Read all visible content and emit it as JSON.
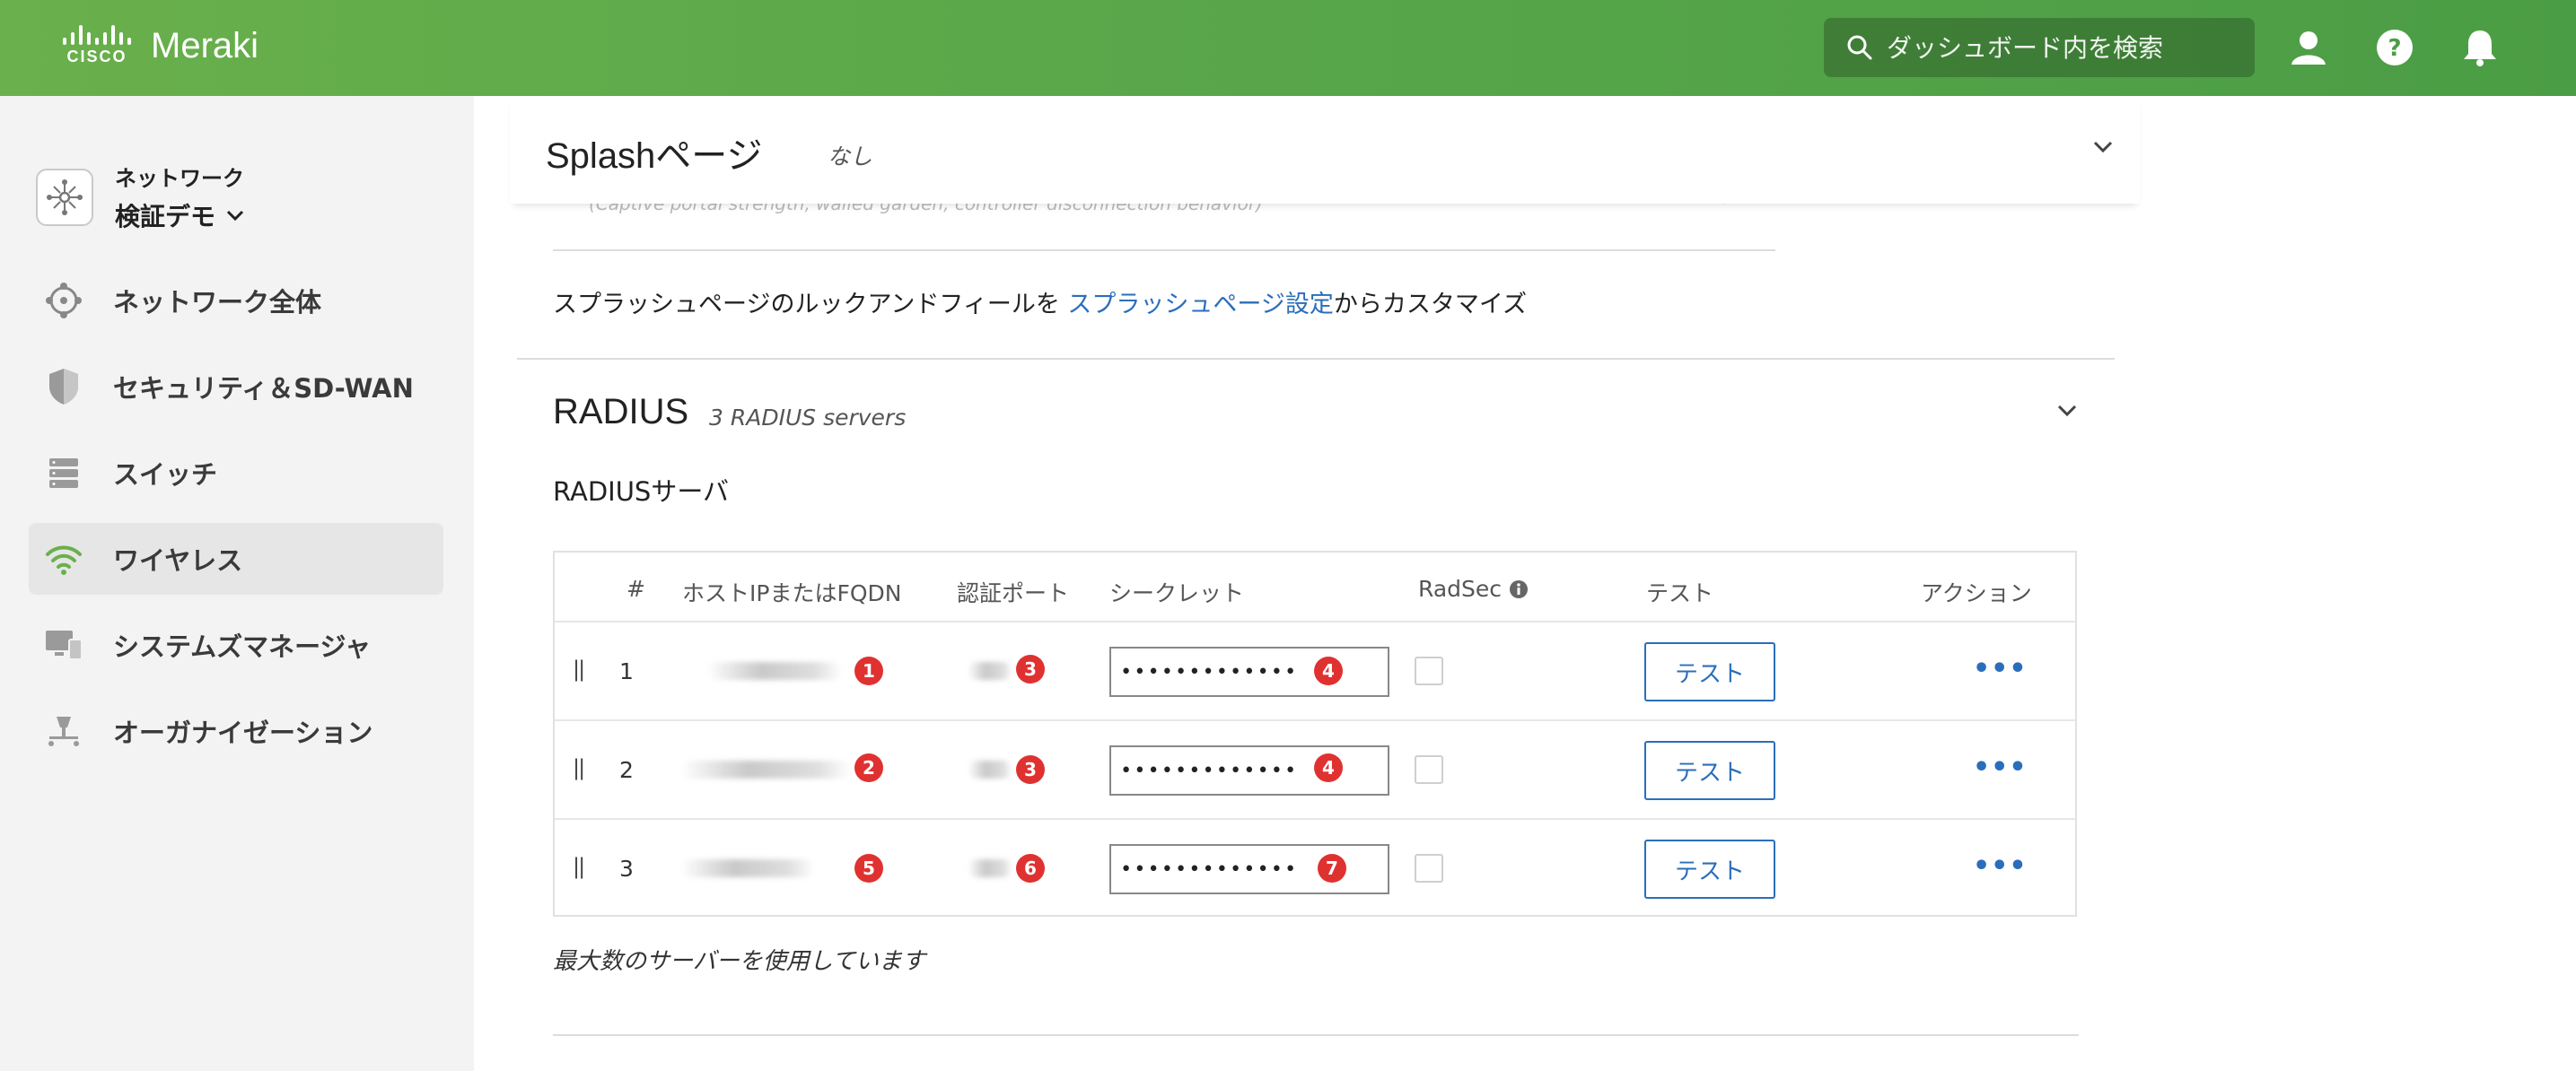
{
  "header": {
    "brand_small": "CISCO",
    "brand": "Meraki",
    "search_placeholder": "ダッシュボード内を検索",
    "colors": {
      "bar_start": "#6ab04c",
      "bar_end": "#4b9d45"
    }
  },
  "sidebar": {
    "network_label": "ネットワーク",
    "network_name": "検証デモ",
    "items": [
      {
        "label": "ネットワーク全体",
        "icon": "network-icon"
      },
      {
        "label": "セキュリティ＆SD-WAN",
        "icon": "shield-icon"
      },
      {
        "label": "スイッチ",
        "icon": "switch-icon"
      },
      {
        "label": "ワイヤレス",
        "icon": "wifi-icon",
        "active": true
      },
      {
        "label": "システムズマネージャ",
        "icon": "devices-icon"
      },
      {
        "label": "オーガナイゼーション",
        "icon": "org-icon"
      }
    ]
  },
  "splash": {
    "title": "Splashページ",
    "status": "なし",
    "faded_row": "(Captive portal strength, walled garden, controller disconnection behavior)",
    "customize_prefix": "スプラッシュページのルックアンドフィールを ",
    "customize_link": "スプラッシュページ設定",
    "customize_suffix": "からカスタマイズ"
  },
  "radius": {
    "title": "RADIUS",
    "summary": "3 RADIUS servers",
    "servers_label": "RADIUSサーバ",
    "columns": {
      "num": "#",
      "host": "ホストIPまたはFQDN",
      "port": "認証ポート",
      "secret": "シークレット",
      "radsec": "RadSec",
      "test": "テスト",
      "action": "アクション"
    },
    "rows": [
      {
        "num": "1",
        "host_badge": "1",
        "port_badge": "3",
        "secret": "•••••••••••••",
        "secret_badge": "4",
        "test_label": "テスト",
        "action": "•••"
      },
      {
        "num": "2",
        "host_badge": "2",
        "port_badge": "3",
        "secret": "•••••••••••••",
        "secret_badge": "4",
        "test_label": "テスト",
        "action": "•••"
      },
      {
        "num": "3",
        "host_badge": "5",
        "port_badge": "6",
        "secret": "•••••••••••••",
        "secret_badge": "7",
        "test_label": "テスト",
        "action": "•••"
      }
    ],
    "max_note": "最大数のサーバーを使用しています"
  }
}
